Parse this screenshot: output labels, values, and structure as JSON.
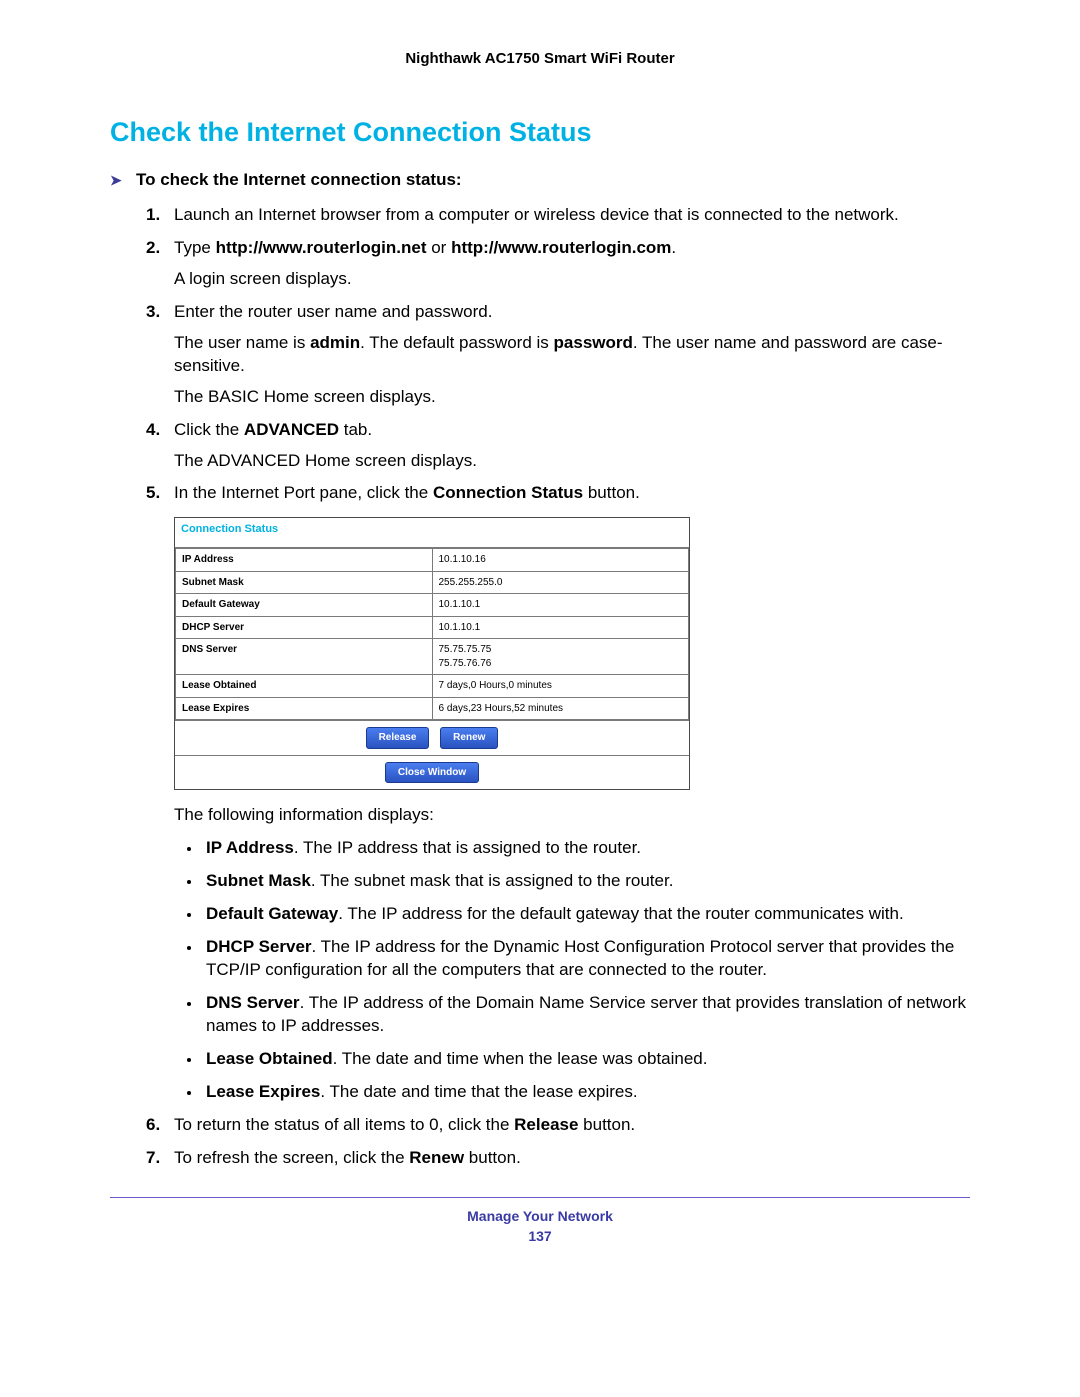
{
  "header": {
    "product": "Nighthawk AC1750 Smart WiFi Router"
  },
  "section": {
    "title": "Check the Internet Connection Status"
  },
  "proc": {
    "heading": "To check the Internet connection status:"
  },
  "steps": [
    {
      "body": "Launch an Internet browser from a computer or wireless device that is connected to the network."
    },
    {
      "prefix": "Type ",
      "bold1": "http://www.routerlogin.net",
      "mid": " or ",
      "bold2": "http://www.routerlogin.com",
      "suffix": ".",
      "para1": "A login screen displays."
    },
    {
      "body": "Enter the router user name and password.",
      "para1_a": "The user name is ",
      "para1_b": "admin",
      "para1_c": ". The default password is ",
      "para1_d": "password",
      "para1_e": ". The user name and password are case-sensitive.",
      "para2": "The BASIC Home screen displays."
    },
    {
      "prefix": "Click the ",
      "bold1": "ADVANCED",
      "suffix": " tab.",
      "para1": "The ADVANCED Home screen displays."
    },
    {
      "prefix": "In the Internet Port pane, click the ",
      "bold1": "Connection Status",
      "suffix": " button.",
      "after_img": "The following information displays:"
    },
    {
      "prefix": "To return the status of all items to 0, click the ",
      "bold1": "Release",
      "suffix": " button."
    },
    {
      "prefix": "To refresh the screen, click the ",
      "bold1": "Renew",
      "suffix": " button."
    }
  ],
  "dialog": {
    "title": "Connection Status",
    "rows": [
      {
        "label": "IP Address",
        "value": "10.1.10.16"
      },
      {
        "label": "Subnet Mask",
        "value": "255.255.255.0"
      },
      {
        "label": "Default Gateway",
        "value": "10.1.10.1"
      },
      {
        "label": "DHCP Server",
        "value": "10.1.10.1"
      },
      {
        "label": "DNS Server",
        "value": "75.75.75.75\n75.75.76.76"
      },
      {
        "label": "Lease Obtained",
        "value": "7 days,0 Hours,0 minutes"
      },
      {
        "label": "Lease Expires",
        "value": "6 days,23 Hours,52 minutes"
      }
    ],
    "buttons": {
      "release": "Release",
      "renew": "Renew",
      "close": "Close Window"
    }
  },
  "bullets": [
    {
      "term": "IP Address",
      "desc": ". The IP address that is assigned to the router."
    },
    {
      "term": "Subnet Mask",
      "desc": ". The subnet mask that is assigned to the router."
    },
    {
      "term": "Default Gateway",
      "desc": ". The IP address for the default gateway that the router communicates with."
    },
    {
      "term": "DHCP Server",
      "desc": ". The IP address for the Dynamic Host Configuration Protocol server that provides the TCP/IP configuration for all the computers that are connected to the router."
    },
    {
      "term": "DNS Server",
      "desc": ". The IP address of the Domain Name Service server that provides translation of network names to IP addresses."
    },
    {
      "term": "Lease Obtained",
      "desc": ". The date and time when the lease was obtained."
    },
    {
      "term": "Lease Expires",
      "desc": ". The date and time that the lease expires."
    }
  ],
  "footer": {
    "chapter": "Manage Your Network",
    "page": "137"
  }
}
